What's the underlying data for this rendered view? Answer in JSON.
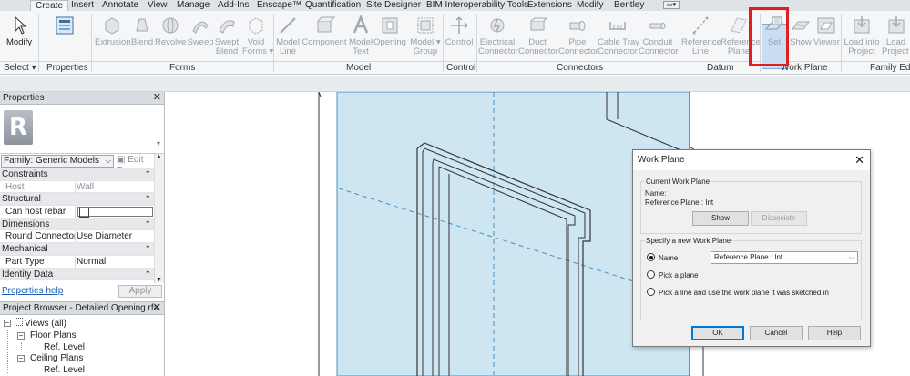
{
  "tabs": [
    {
      "label": "Create",
      "active": true
    },
    {
      "label": "Insert"
    },
    {
      "label": "Annotate"
    },
    {
      "label": "View"
    },
    {
      "label": "Manage"
    },
    {
      "label": "Add-Ins"
    },
    {
      "label": "Enscape™"
    },
    {
      "label": "Quantification"
    },
    {
      "label": "Site Designer"
    },
    {
      "label": "BIM Interoperability Tools"
    },
    {
      "label": "Extensions"
    },
    {
      "label": "Modify"
    },
    {
      "label": "Bentley"
    }
  ],
  "ribbon": {
    "tools": {
      "modify": "Modify",
      "extrusion": "Extrusion",
      "blend": "Blend",
      "revolve": "Revolve",
      "sweep": "Sweep",
      "swept_blend_1": "Swept",
      "swept_blend_2": "Blend",
      "void_forms_1": "Void",
      "void_forms_2": "Forms",
      "model_line_1": "Model",
      "model_line_2": "Line",
      "component": "Component",
      "model_text_1": "Model",
      "model_text_2": "Text",
      "opening": "Opening",
      "model_group_1": "Model",
      "model_group_2": "Group",
      "control": "Control",
      "electrical_connector_1": "Electrical",
      "electrical_connector_2": "Connector",
      "duct_connector_1": "Duct",
      "duct_connector_2": "Connector",
      "pipe_connector_1": "Pipe",
      "pipe_connector_2": "Connector",
      "cable_tray_connector_1": "Cable Tray",
      "cable_tray_connector_2": "Connector",
      "conduit_connector_1": "Conduit",
      "conduit_connector_2": "Connector",
      "reference_line_1": "Reference",
      "reference_line_2": "Line",
      "reference_plane_1": "Reference",
      "reference_plane_2": "Plane",
      "set": "Set",
      "show": "Show",
      "viewer": "Viewer",
      "load_into_project_1": "Load into",
      "load_into_project_2": "Project",
      "load_into_project_close_1": "Load",
      "load_into_project_close_2": "Project a"
    },
    "panels": {
      "select": "Select ▾",
      "properties": "Properties",
      "forms": "Forms",
      "model": "Model",
      "control": "Control",
      "connectors": "Connectors",
      "datum": "Datum",
      "work_plane": "Work Plane",
      "family_editor": "Family Edito"
    }
  },
  "properties": {
    "title": "Properties",
    "family_select": "Family: Generic Models",
    "edit_type": "Edit Type",
    "rows": [
      {
        "type": "category",
        "label": "Constraints"
      },
      {
        "type": "param",
        "key": "Host",
        "value": "Wall",
        "muted": true
      },
      {
        "type": "category",
        "label": "Structural"
      },
      {
        "type": "checkbox",
        "key": "Can host rebar",
        "checked": false
      },
      {
        "type": "category",
        "label": "Dimensions"
      },
      {
        "type": "param",
        "key": "Round Connector ...",
        "value": "Use Diameter"
      },
      {
        "type": "category",
        "label": "Mechanical"
      },
      {
        "type": "param",
        "key": "Part Type",
        "value": "Normal"
      },
      {
        "type": "category",
        "label": "Identity Data"
      }
    ],
    "help_link": "Properties help",
    "apply": "Apply"
  },
  "browser": {
    "title": "Project Browser - Detailed Opening.rfa",
    "views_all": "Views (all)",
    "floor_plans": "Floor Plans",
    "ref_level_1": "Ref. Level",
    "ceiling_plans": "Ceiling Plans",
    "ref_level_2": "Ref. Level"
  },
  "dialog": {
    "title": "Work Plane",
    "current_group": "Current Work Plane",
    "name_label": "Name:",
    "name_value": "Reference Plane : Int",
    "show_btn": "Show",
    "dissociate_btn": "Dissociate",
    "new_group": "Specify a new Work Plane",
    "opt_name": "Name",
    "name_select": "Reference Plane : Int",
    "opt_pick_plane": "Pick a plane",
    "opt_pick_line": "Pick a line and use the work plane it was sketched in",
    "ok": "OK",
    "cancel": "Cancel",
    "help": "Help"
  },
  "colors": {
    "accent_highlight": "#e01e1e",
    "plane_fill": "#cde6f2",
    "plane_stroke": "#4a90c2"
  }
}
